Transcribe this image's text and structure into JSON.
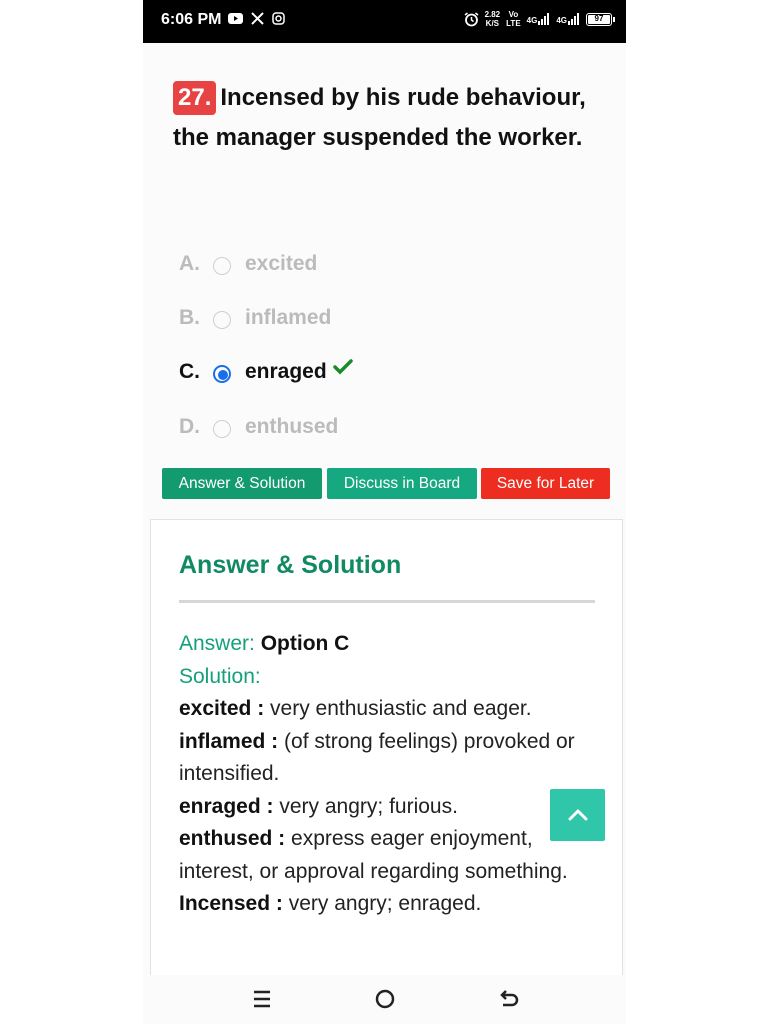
{
  "status_bar": {
    "time": "6:06 PM",
    "net_speed_value": "2.82",
    "net_speed_unit": "K/S",
    "volte_top": "Vo",
    "volte_bottom": "LTE",
    "sim1": "4G",
    "sim2": "4G",
    "battery": "97"
  },
  "question": {
    "number": "27.",
    "text": "Incensed by his rude behaviour, the manager suspended the worker."
  },
  "options": [
    {
      "letter": "A.",
      "text": "excited",
      "selected": false
    },
    {
      "letter": "B.",
      "text": "inflamed",
      "selected": false
    },
    {
      "letter": "C.",
      "text": "enraged",
      "selected": true
    },
    {
      "letter": "D.",
      "text": "enthused",
      "selected": false
    }
  ],
  "buttons": {
    "answer": "Answer & Solution",
    "discuss": "Discuss in Board",
    "save": "Save for Later"
  },
  "solution": {
    "title": "Answer & Solution",
    "answer_label": "Answer:",
    "answer_value": "Option C",
    "solution_label": "Solution:",
    "entries": [
      {
        "term": "excited :",
        "definition": "very enthusiastic and eager."
      },
      {
        "term": "inflamed :",
        "definition": "(of strong feelings) provoked or intensified."
      },
      {
        "term": "enraged :",
        "definition": "very angry; furious."
      },
      {
        "term": "enthused :",
        "definition": "express eager enjoyment, interest, or approval regarding something."
      },
      {
        "term": "Incensed :",
        "definition": "very angry; enraged."
      }
    ]
  },
  "colors": {
    "question_badge": "#e84343",
    "accent_green": "#16a07a",
    "save_red": "#ec2d1f",
    "radio_blue": "#1a6fe8"
  }
}
